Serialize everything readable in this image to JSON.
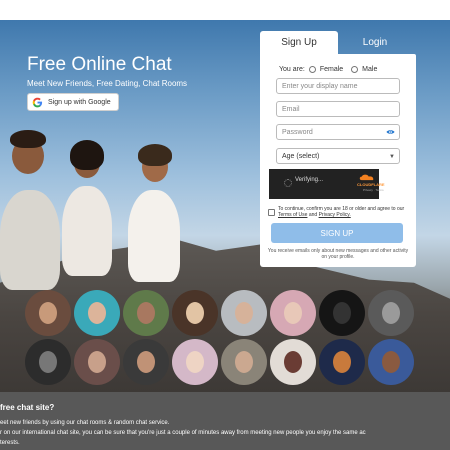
{
  "hero": {
    "title": "Free Online Chat",
    "subtitle": "Meet New Friends, Free Dating, Chat Rooms",
    "google_button": "Sign up with Google"
  },
  "tabs": {
    "signup": "Sign Up",
    "login": "Login"
  },
  "form": {
    "gender_label": "You are:",
    "gender_female": "Female",
    "gender_male": "Male",
    "display_name_placeholder": "Enter your display name",
    "email_placeholder": "Email",
    "password_placeholder": "Password",
    "age_select": "Age (select)",
    "captcha_status": "Verifying...",
    "captcha_brand": "CLOUDFLARE",
    "captcha_links": "Privacy · Terms",
    "confirm_prefix": "To continue, confirm you are 18 or older and agree to our",
    "terms_link": "Terms of Use",
    "and_text": "and",
    "privacy_link": "Privacy Policy.",
    "signup_button": "SIGN UP",
    "email_note": "You receive emails only about new messages and other activity on your profile."
  },
  "footer": {
    "heading": "free chat site?",
    "line1": "eet new friends by using our chat rooms & random chat service.",
    "line2": "r on our international chat site, you can be sure that you're just a couple of minutes away from meeting new people you enjoy the same ac",
    "line3": "terests."
  },
  "colors": {
    "accent": "#8fbde9",
    "footer_bg": "#585858",
    "eye_icon": "#2a7bd0"
  }
}
